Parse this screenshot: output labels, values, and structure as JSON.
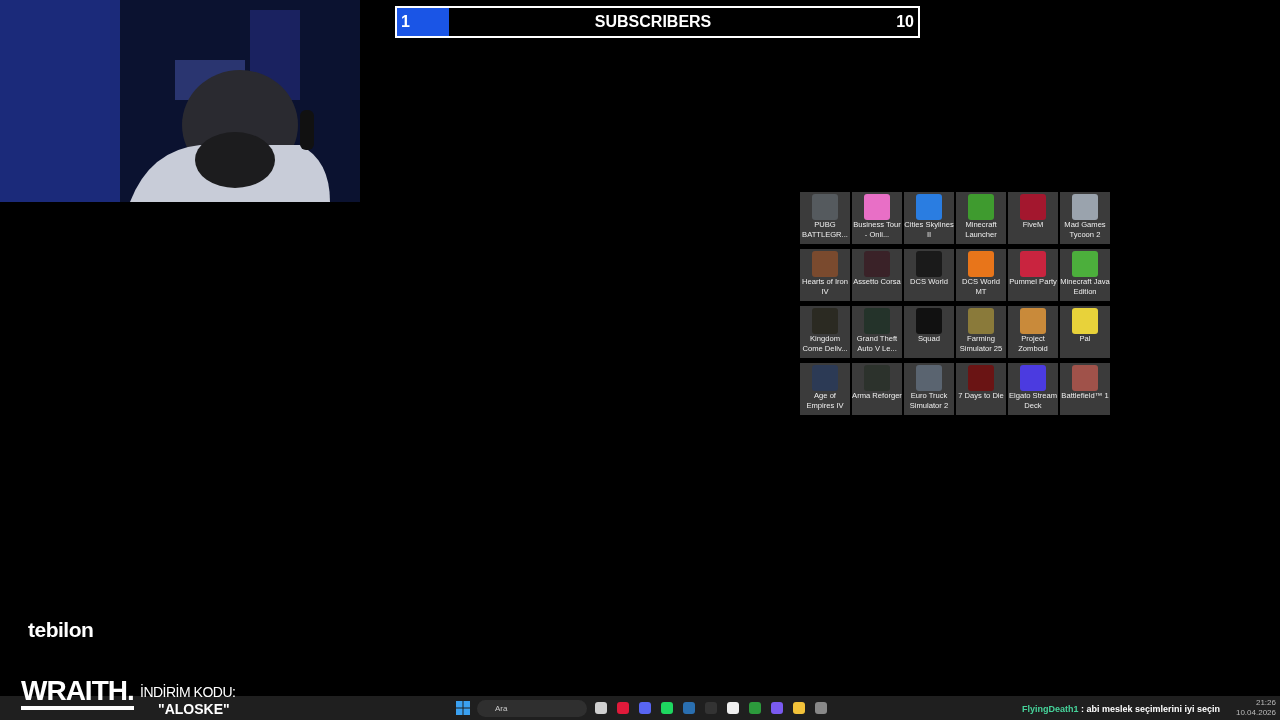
{
  "subscriber_goal": {
    "current": "1",
    "title": "SUBSCRIBERS",
    "target": "10",
    "level": 0.1
  },
  "desktop_icons": [
    {
      "label": "PUBG BATTLEGR...",
      "color": "#555a5e"
    },
    {
      "label": "Business Tour - Onli...",
      "color": "#e86fc6"
    },
    {
      "label": "Cities Skylines II",
      "color": "#2a7de1"
    },
    {
      "label": "Minecraft Launcher",
      "color": "#3f9b2f"
    },
    {
      "label": "FiveM",
      "color": "#a3172e"
    },
    {
      "label": "Mad Games Tycoon 2",
      "color": "#9aa3ad"
    },
    {
      "label": "Hearts of Iron IV",
      "color": "#7a4a2e"
    },
    {
      "label": "Assetto Corsa",
      "color": "#3a2228"
    },
    {
      "label": "DCS World",
      "color": "#1a1a1a"
    },
    {
      "label": "DCS World MT",
      "color": "#e8751a"
    },
    {
      "label": "Pummel Party",
      "color": "#c9243f"
    },
    {
      "label": "Minecraft Java Edition",
      "color": "#4caf3c"
    },
    {
      "label": "Kingdom Come Deliv...",
      "color": "#2b2a22"
    },
    {
      "label": "Grand Theft Auto V Le...",
      "color": "#24332a"
    },
    {
      "label": "Squad",
      "color": "#111111"
    },
    {
      "label": "Farming Simulator 25",
      "color": "#8a7a3a"
    },
    {
      "label": "Project Zomboid",
      "color": "#c98a3a"
    },
    {
      "label": "Pal",
      "color": "#e8d23a"
    },
    {
      "label": "Age of Empires IV",
      "color": "#2c3a55"
    },
    {
      "label": "Arma Reforger",
      "color": "#2c322c"
    },
    {
      "label": "Euro Truck Simulator 2",
      "color": "#5a6470"
    },
    {
      "label": "7 Days to Die",
      "color": "#6a1414"
    },
    {
      "label": "Elgato Stream Deck",
      "color": "#4b3be0"
    },
    {
      "label": "Battlefield™ 1",
      "color": "#a0524a"
    }
  ],
  "sponsor": {
    "logo": "tebilon",
    "brand": "WRAITH.",
    "code_label": "İNDİRİM KODU:",
    "code": "\"ALOSKE\""
  },
  "taskbar": {
    "search_placeholder": "Ara",
    "clock_time": "21:26",
    "clock_date": "10.04.2026"
  },
  "chat_message": {
    "user": "FlyingDeath1",
    "text": ": abi meslek seçimlerini iyi seçin"
  }
}
